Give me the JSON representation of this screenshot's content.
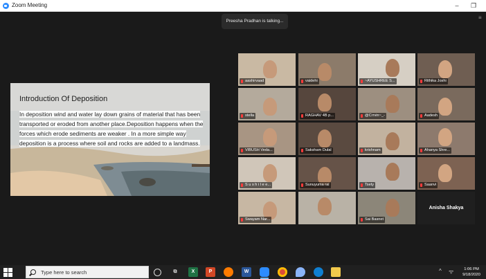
{
  "window": {
    "title": "Zoom Meeting",
    "minimize_glyph": "–",
    "maximize_glyph": "❐",
    "app_icon": "zoom-camera-icon"
  },
  "meeting": {
    "talking_banner": "Preesha Pradhan is talking...",
    "active_speaker_color": "#f5d000"
  },
  "slide": {
    "title": "Introduction Of Deposition",
    "body": "In deposition wind and water lay down grains of material that has been transported or eroded from another place.Deposition happens when the forces which erode sediments are weaker . In a more simple way deposition is a process where soil and rocks are added to a landmass."
  },
  "participants": [
    {
      "name": "aashirvaad"
    },
    {
      "name": "vaidehi"
    },
    {
      "name": "~AYUSHREE S..."
    },
    {
      "name": "Rithika Joshi"
    },
    {
      "name": "stella"
    },
    {
      "name": "RAGHAV 4B p..."
    },
    {
      "name": "@Crrvin~_-"
    },
    {
      "name": "Aadesh"
    },
    {
      "name": "VIBUSH Veda..."
    },
    {
      "name": "Saksham Dulal"
    },
    {
      "name": "krishnam"
    },
    {
      "name": "Ahanya Shre..."
    },
    {
      "name": "S u s h i l e e..."
    },
    {
      "name": "Sunuyuma rai"
    },
    {
      "name": "Tsety"
    },
    {
      "name": "Saanvi"
    },
    {
      "name": "Swayam Nar..."
    },
    {
      "name": ""
    },
    {
      "name": "Sai Basnet"
    },
    {
      "name": "Anisha Shakya"
    }
  ],
  "taskbar": {
    "search_placeholder": "Type here to search",
    "apps": [
      "task-view-icon",
      "excel-icon",
      "powerpoint-icon",
      "firefox-icon",
      "word-icon",
      "zoom-icon",
      "chrome-icon",
      "paint-icon",
      "edge-icon",
      "file-explorer-icon"
    ],
    "tray_up": "^",
    "tray_network": "ᯤ",
    "time": "1:06 PM",
    "date": "9/18/2020"
  }
}
